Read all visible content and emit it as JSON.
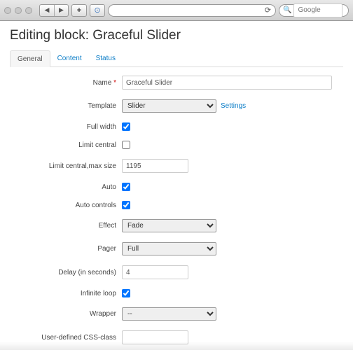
{
  "browser": {
    "search_placeholder": "Google"
  },
  "page": {
    "title": "Editing block: Graceful Slider"
  },
  "tabs": [
    {
      "label": "General",
      "active": true
    },
    {
      "label": "Content",
      "active": false
    },
    {
      "label": "Status",
      "active": false
    }
  ],
  "form": {
    "name": {
      "label": "Name",
      "value": "Graceful Slider",
      "required": true
    },
    "template": {
      "label": "Template",
      "value": "Slider",
      "settings_link": "Settings"
    },
    "full_width": {
      "label": "Full width",
      "checked": true
    },
    "limit_central": {
      "label": "Limit central",
      "checked": false
    },
    "limit_central_max": {
      "label": "Limit central,max size",
      "value": "1195"
    },
    "auto": {
      "label": "Auto",
      "checked": true
    },
    "auto_controls": {
      "label": "Auto controls",
      "checked": true
    },
    "effect": {
      "label": "Effect",
      "value": "Fade"
    },
    "pager": {
      "label": "Pager",
      "value": "Full"
    },
    "delay": {
      "label": "Delay (in seconds)",
      "value": "4"
    },
    "infinite_loop": {
      "label": "Infinite loop",
      "checked": true
    },
    "wrapper": {
      "label": "Wrapper",
      "value": "--"
    },
    "css_class": {
      "label": "User-defined CSS-class",
      "value": ""
    }
  }
}
